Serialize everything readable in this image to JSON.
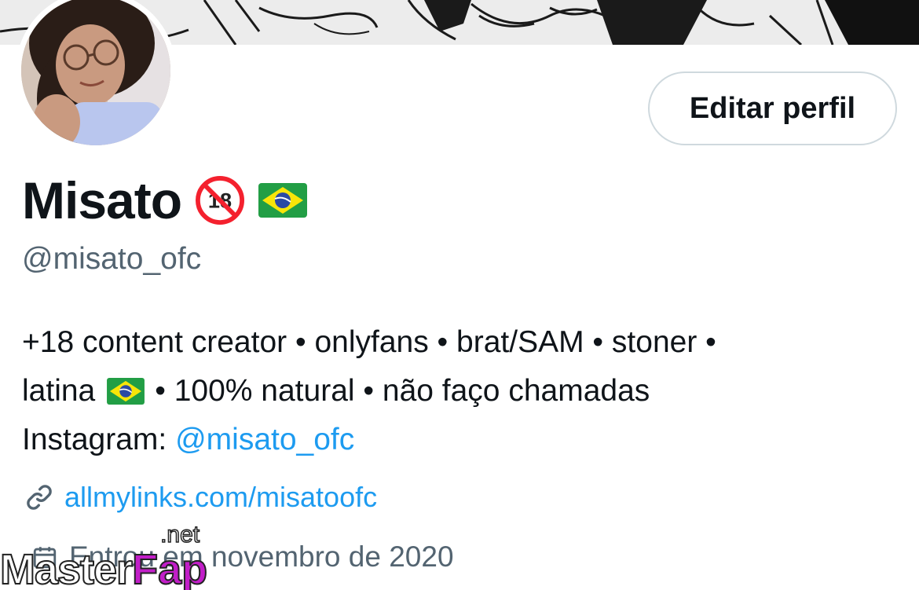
{
  "profile": {
    "display_name": "Misato",
    "handle": "@misato_ofc",
    "edit_button_label": "Editar perfil",
    "bio": {
      "line1": "+18 content creator • onlyfans • brat/SAM • stoner •",
      "line2_start": "latina",
      "line2_end": "• 100% natural • não faço chamadas",
      "line3_prefix": "Instagram:",
      "line3_link": "@misato_ofc"
    },
    "website": "allmylinks.com/misatoofc",
    "joined": "Entrou em novembro de 2020"
  },
  "icons": {
    "no_under_18": "no-one-under-eighteen-icon",
    "flag": "brazil-flag-icon",
    "link": "link-icon",
    "calendar": "calendar-icon"
  },
  "watermark": {
    "part1": "Master",
    "part2": "Fap",
    "part3": ".net"
  },
  "colors": {
    "link": "#1d9bf0",
    "secondary_text": "#536471",
    "border": "#cfd9de",
    "watermark_accent": "#c21ec8"
  }
}
